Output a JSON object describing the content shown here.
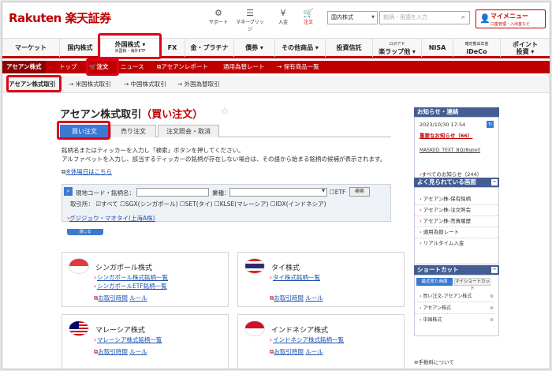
{
  "header": {
    "logo": "Rakuten 楽天証券",
    "icons": [
      {
        "label": "サポート",
        "icon": "support-icon"
      },
      {
        "label": "マネーブリッジ",
        "icon": "bridge-icon"
      },
      {
        "label": "入金",
        "icon": "deposit-icon"
      },
      {
        "label": "注文",
        "icon": "cart-icon"
      }
    ],
    "search_select": "国内株式",
    "search_placeholder": "銘柄・用語を入力",
    "mymenu": "マイメニュー",
    "mymenu_sub": "口座管理・入出金など"
  },
  "nav": [
    {
      "l1": "マーケット"
    },
    {
      "l1": "国内株式"
    },
    {
      "l1": "外国株式",
      "l2": "米国株・海外ETF"
    },
    {
      "l1": "FX"
    },
    {
      "l1": "金・プラチナ"
    },
    {
      "l1": "債券"
    },
    {
      "l1": "その他商品"
    },
    {
      "l1": "投資信託"
    },
    {
      "l1": "ロボアド",
      "l2": "楽ラップ他"
    },
    {
      "l1": "NISA"
    },
    {
      "l1": "確定拠出年金",
      "l2": "iDeCo"
    },
    {
      "l1": "ポイント",
      "l2": "投資"
    }
  ],
  "subnav": [
    "アセアン株式",
    "トップ",
    "注文",
    "ニュース",
    "アセアンレポート",
    "通用為替レート",
    "保有商品一覧"
  ],
  "subnav3": [
    "アセアン株式取引",
    "米国株式取引",
    "中国株式取引",
    "外国為替取引"
  ],
  "page": {
    "title": "アセアン株式取引",
    "title_red": "（買い注文）"
  },
  "tabs": [
    "買い注文",
    "売り注文",
    "注文照会・取消"
  ],
  "desc": [
    "銘柄名またはティッカーを入力し「検索」ボタンを押してください。",
    "アルファベットを入力し、該当するティッカーの銘柄が存在しない場合は、その語から始まる銘柄の候補が表示されます。"
  ],
  "holiday": "※休場日はこちら",
  "query": {
    "code_label": "現地コード・銘柄名：",
    "sector_label": "業種：",
    "etf": "ETF",
    "search_btn": "検索",
    "market_label": "取引所：",
    "markets": [
      "すべて",
      "SGX(シンガポール)",
      "SET(タイ)",
      "KLSE(マレーシア)",
      "IDX(インドネシア)"
    ]
  },
  "gz": "グジジョウ・マオタイ(上海A株)",
  "close": "閉じる",
  "boxes": [
    {
      "name": "シンガポール株式",
      "links": [
        "シンガポール株式銘柄一覧",
        "シンガポールETF銘柄一覧"
      ],
      "time": "お取引時間",
      "rule": "ルール"
    },
    {
      "name": "タイ株式",
      "links": [
        "タイ株式銘柄一覧"
      ],
      "time": "お取引時間",
      "rule": "ルール"
    },
    {
      "name": "マレーシア株式",
      "links": [
        "マレーシア株式銘柄一覧"
      ],
      "time": "お取引時間",
      "rule": "ルール"
    },
    {
      "name": "インドネシア株式",
      "links": [
        "インドネシア株式銘柄一覧"
      ],
      "time": "お取引時間",
      "rule": "ルール"
    }
  ],
  "side": {
    "news_title": "お知らせ・連絡",
    "news_date": "2023/10/30 17:54",
    "news_important": "重要なお知らせ（66）",
    "news_masked": "MASKED_TEXT_BQz8gox0",
    "news_all": "すべてのお知らせ（244）",
    "seen_title": "よく見られている画面",
    "seen": [
      "アセアン株-保有銘柄",
      "アセアン株-注文照会",
      "アセアン株-売買履歴",
      "適用為替レート",
      "リアルタイム入金"
    ],
    "short_title": "ショートカット",
    "short_tabs": [
      "最近見た画面",
      "マイショートカット"
    ],
    "short": [
      "買い注文-アセアン株式",
      "アセアン株式",
      "中国株式"
    ],
    "fee": "手数料について"
  }
}
